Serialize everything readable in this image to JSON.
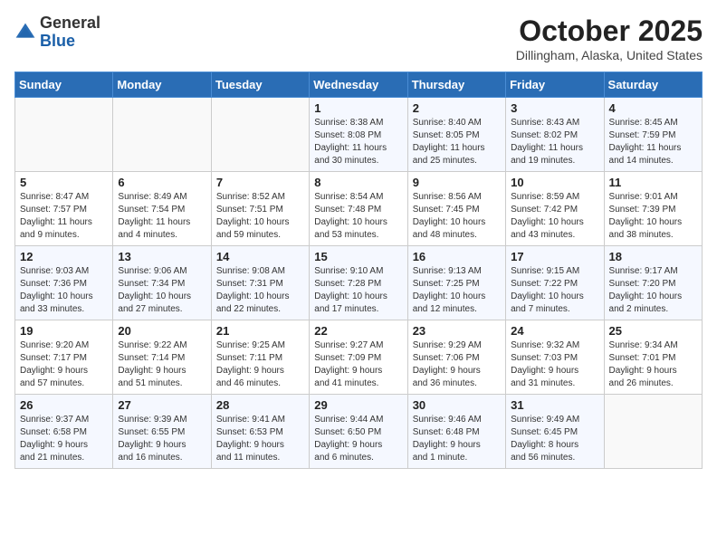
{
  "header": {
    "logo": {
      "general": "General",
      "blue": "Blue"
    },
    "title": "October 2025",
    "subtitle": "Dillingham, Alaska, United States"
  },
  "days_of_week": [
    "Sunday",
    "Monday",
    "Tuesday",
    "Wednesday",
    "Thursday",
    "Friday",
    "Saturday"
  ],
  "weeks": [
    [
      {
        "day": "",
        "info": ""
      },
      {
        "day": "",
        "info": ""
      },
      {
        "day": "",
        "info": ""
      },
      {
        "day": "1",
        "info": "Sunrise: 8:38 AM\nSunset: 8:08 PM\nDaylight: 11 hours\nand 30 minutes."
      },
      {
        "day": "2",
        "info": "Sunrise: 8:40 AM\nSunset: 8:05 PM\nDaylight: 11 hours\nand 25 minutes."
      },
      {
        "day": "3",
        "info": "Sunrise: 8:43 AM\nSunset: 8:02 PM\nDaylight: 11 hours\nand 19 minutes."
      },
      {
        "day": "4",
        "info": "Sunrise: 8:45 AM\nSunset: 7:59 PM\nDaylight: 11 hours\nand 14 minutes."
      }
    ],
    [
      {
        "day": "5",
        "info": "Sunrise: 8:47 AM\nSunset: 7:57 PM\nDaylight: 11 hours\nand 9 minutes."
      },
      {
        "day": "6",
        "info": "Sunrise: 8:49 AM\nSunset: 7:54 PM\nDaylight: 11 hours\nand 4 minutes."
      },
      {
        "day": "7",
        "info": "Sunrise: 8:52 AM\nSunset: 7:51 PM\nDaylight: 10 hours\nand 59 minutes."
      },
      {
        "day": "8",
        "info": "Sunrise: 8:54 AM\nSunset: 7:48 PM\nDaylight: 10 hours\nand 53 minutes."
      },
      {
        "day": "9",
        "info": "Sunrise: 8:56 AM\nSunset: 7:45 PM\nDaylight: 10 hours\nand 48 minutes."
      },
      {
        "day": "10",
        "info": "Sunrise: 8:59 AM\nSunset: 7:42 PM\nDaylight: 10 hours\nand 43 minutes."
      },
      {
        "day": "11",
        "info": "Sunrise: 9:01 AM\nSunset: 7:39 PM\nDaylight: 10 hours\nand 38 minutes."
      }
    ],
    [
      {
        "day": "12",
        "info": "Sunrise: 9:03 AM\nSunset: 7:36 PM\nDaylight: 10 hours\nand 33 minutes."
      },
      {
        "day": "13",
        "info": "Sunrise: 9:06 AM\nSunset: 7:34 PM\nDaylight: 10 hours\nand 27 minutes."
      },
      {
        "day": "14",
        "info": "Sunrise: 9:08 AM\nSunset: 7:31 PM\nDaylight: 10 hours\nand 22 minutes."
      },
      {
        "day": "15",
        "info": "Sunrise: 9:10 AM\nSunset: 7:28 PM\nDaylight: 10 hours\nand 17 minutes."
      },
      {
        "day": "16",
        "info": "Sunrise: 9:13 AM\nSunset: 7:25 PM\nDaylight: 10 hours\nand 12 minutes."
      },
      {
        "day": "17",
        "info": "Sunrise: 9:15 AM\nSunset: 7:22 PM\nDaylight: 10 hours\nand 7 minutes."
      },
      {
        "day": "18",
        "info": "Sunrise: 9:17 AM\nSunset: 7:20 PM\nDaylight: 10 hours\nand 2 minutes."
      }
    ],
    [
      {
        "day": "19",
        "info": "Sunrise: 9:20 AM\nSunset: 7:17 PM\nDaylight: 9 hours\nand 57 minutes."
      },
      {
        "day": "20",
        "info": "Sunrise: 9:22 AM\nSunset: 7:14 PM\nDaylight: 9 hours\nand 51 minutes."
      },
      {
        "day": "21",
        "info": "Sunrise: 9:25 AM\nSunset: 7:11 PM\nDaylight: 9 hours\nand 46 minutes."
      },
      {
        "day": "22",
        "info": "Sunrise: 9:27 AM\nSunset: 7:09 PM\nDaylight: 9 hours\nand 41 minutes."
      },
      {
        "day": "23",
        "info": "Sunrise: 9:29 AM\nSunset: 7:06 PM\nDaylight: 9 hours\nand 36 minutes."
      },
      {
        "day": "24",
        "info": "Sunrise: 9:32 AM\nSunset: 7:03 PM\nDaylight: 9 hours\nand 31 minutes."
      },
      {
        "day": "25",
        "info": "Sunrise: 9:34 AM\nSunset: 7:01 PM\nDaylight: 9 hours\nand 26 minutes."
      }
    ],
    [
      {
        "day": "26",
        "info": "Sunrise: 9:37 AM\nSunset: 6:58 PM\nDaylight: 9 hours\nand 21 minutes."
      },
      {
        "day": "27",
        "info": "Sunrise: 9:39 AM\nSunset: 6:55 PM\nDaylight: 9 hours\nand 16 minutes."
      },
      {
        "day": "28",
        "info": "Sunrise: 9:41 AM\nSunset: 6:53 PM\nDaylight: 9 hours\nand 11 minutes."
      },
      {
        "day": "29",
        "info": "Sunrise: 9:44 AM\nSunset: 6:50 PM\nDaylight: 9 hours\nand 6 minutes."
      },
      {
        "day": "30",
        "info": "Sunrise: 9:46 AM\nSunset: 6:48 PM\nDaylight: 9 hours\nand 1 minute."
      },
      {
        "day": "31",
        "info": "Sunrise: 9:49 AM\nSunset: 6:45 PM\nDaylight: 8 hours\nand 56 minutes."
      },
      {
        "day": "",
        "info": ""
      }
    ]
  ]
}
